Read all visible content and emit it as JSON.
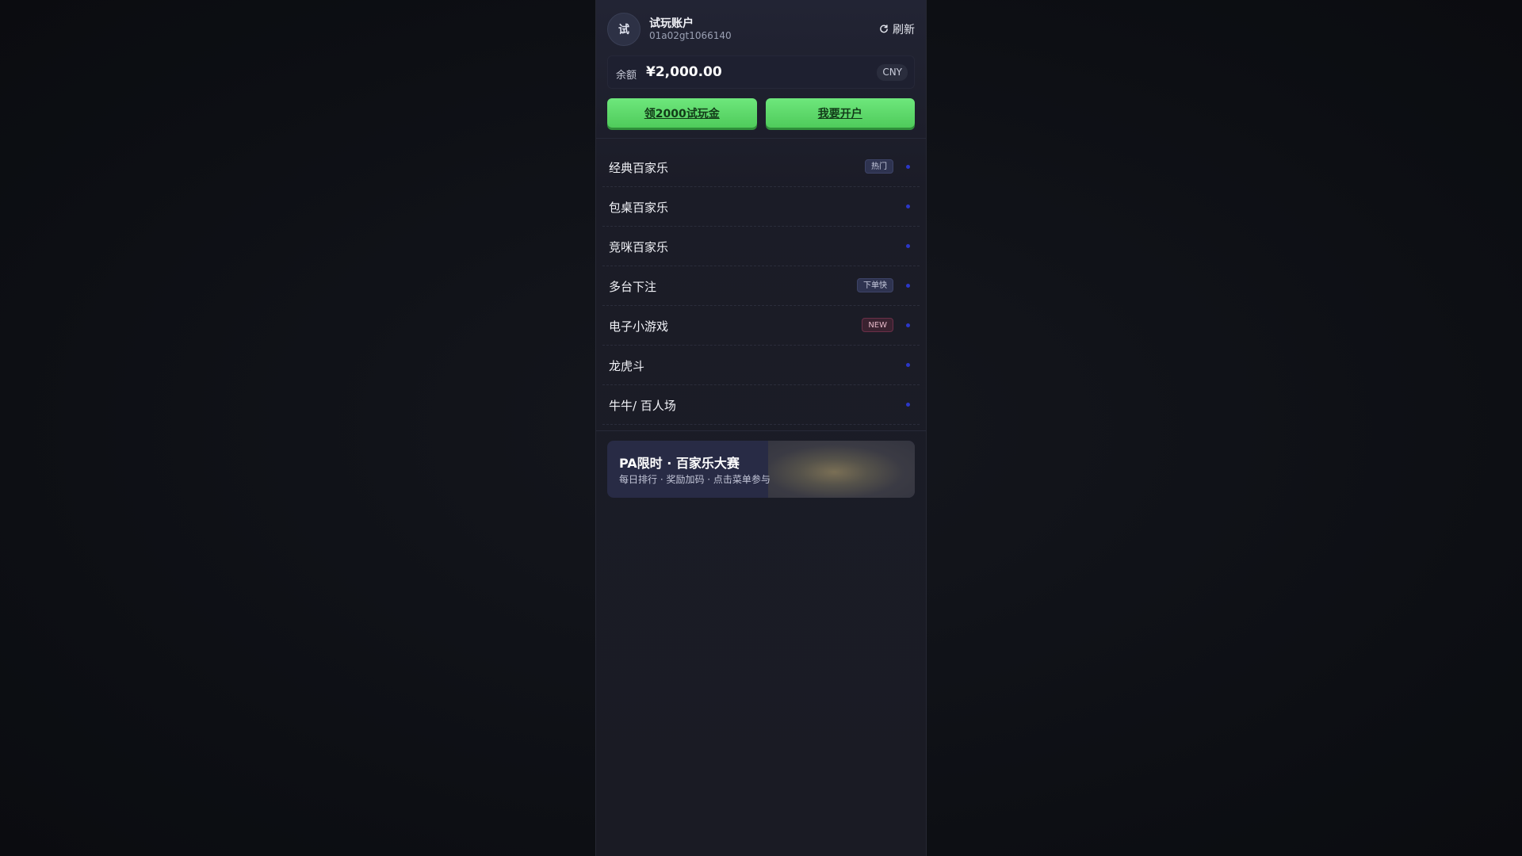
{
  "account": {
    "avatar_text": "试",
    "name": "试玩账户",
    "id": "01a02gt1066140",
    "refresh_label": "刷新"
  },
  "balance": {
    "label": "余额",
    "value": "¥2,000.00",
    "currency": "CNY"
  },
  "actions": {
    "trial_label": "领2000试玩金",
    "open_account_label": "我要开户"
  },
  "menu": {
    "items": [
      {
        "label": "经典百家乐",
        "badge": "热门"
      },
      {
        "label": "包桌百家乐",
        "badge": ""
      },
      {
        "label": "竞咪百家乐",
        "badge": ""
      },
      {
        "label": "多台下注",
        "badge": "下单快"
      },
      {
        "label": "电子小游戏",
        "badge": "NEW"
      },
      {
        "label": "龙虎斗",
        "badge": ""
      },
      {
        "label": "牛牛/ 百人场",
        "badge": ""
      }
    ]
  },
  "promo": {
    "title": "PA限时 · 百家乐大赛",
    "subtitle": "每日排行 · 奖励加码 · 点击菜单参与"
  },
  "colors": {
    "accent_green": "#5ad866",
    "dot_blue": "#2b37c8",
    "panel_bg": "#1b1c27"
  }
}
